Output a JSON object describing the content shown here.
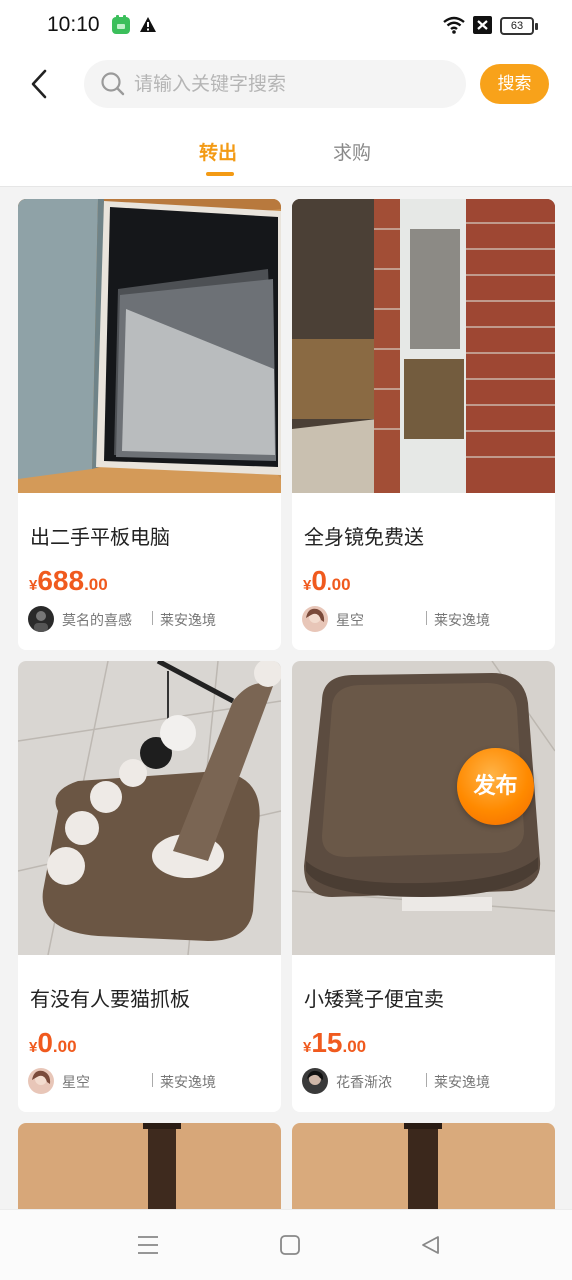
{
  "status_bar": {
    "time": "10:10",
    "battery": "63"
  },
  "search": {
    "placeholder": "请输入关键字搜索",
    "button_label": "搜索"
  },
  "tabs": [
    {
      "label": "转出",
      "active": true
    },
    {
      "label": "求购",
      "active": false
    }
  ],
  "listings": [
    {
      "title": "出二手平板电脑",
      "price_symbol": "¥",
      "price_int": "688",
      "price_dec": ".00",
      "seller": "莫名的喜感",
      "community": "莱安逸境"
    },
    {
      "title": "全身镜免费送",
      "price_symbol": "¥",
      "price_int": "0",
      "price_dec": ".00",
      "seller": "星空",
      "community": "莱安逸境"
    },
    {
      "title": "有没有人要猫抓板",
      "price_symbol": "¥",
      "price_int": "0",
      "price_dec": ".00",
      "seller": "星空",
      "community": "莱安逸境"
    },
    {
      "title": "小矮凳子便宜卖",
      "price_symbol": "¥",
      "price_int": "15",
      "price_dec": ".00",
      "seller": "花香渐浓",
      "community": "莱安逸境"
    }
  ],
  "publish_button": {
    "label": "发布"
  },
  "colors": {
    "accent": "#f39a14",
    "price": "#f05a1e",
    "search_button": "#f8a21a"
  },
  "icons": [
    "back-icon",
    "search-icon",
    "wifi-icon",
    "warning-icon",
    "app-notification-icon",
    "menu-icon",
    "home-icon",
    "back-triangle-icon"
  ]
}
